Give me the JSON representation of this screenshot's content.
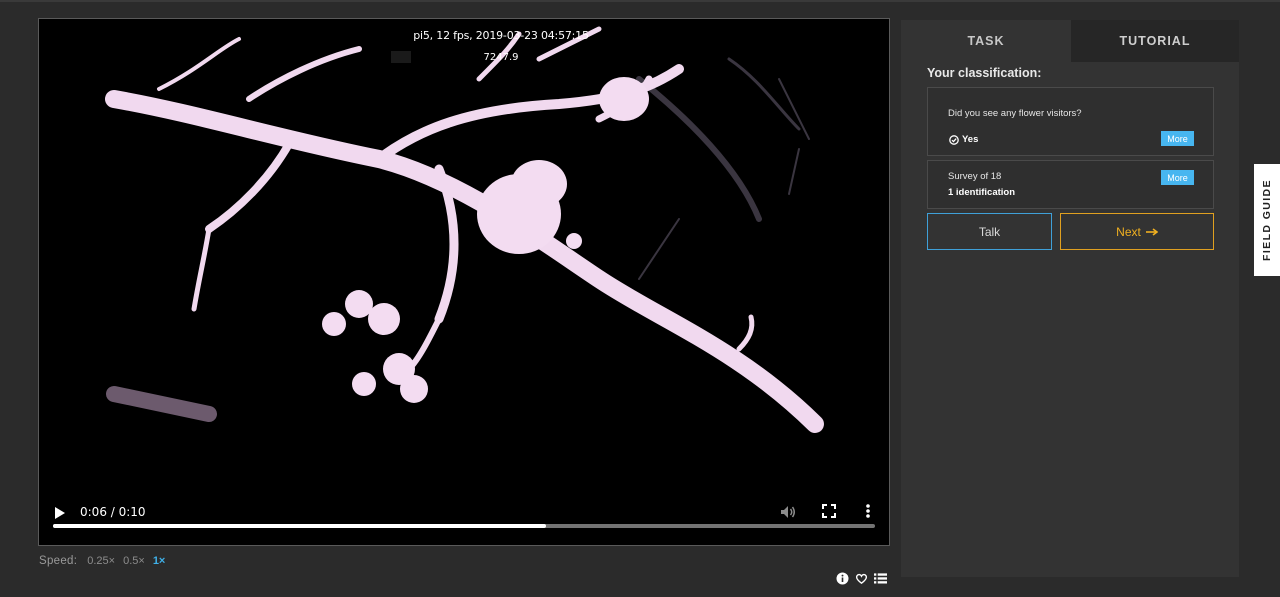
{
  "video": {
    "overlay_line1": "pi5, 12 fps, 2019-03-23 04:57:15",
    "overlay_line2": "7247.9",
    "time": "0:06 / 0:10",
    "progress_percent": 60,
    "icons": [
      "play-icon",
      "volume-icon",
      "fullscreen-icon",
      "more-vertical-icon"
    ]
  },
  "speed": {
    "label": "Speed:",
    "options": [
      "0.25×",
      "0.5×",
      "1×"
    ],
    "active": "1×"
  },
  "meta_icons": [
    "info-icon",
    "heart-icon",
    "list-icon"
  ],
  "tabs": {
    "task": "TASK",
    "tutorial": "TUTORIAL",
    "active": "TASK"
  },
  "classification": {
    "title": "Your classification:",
    "question": "Did you see any flower visitors?",
    "answer": "Yes",
    "more_label": "More",
    "survey_title": "Survey of 18",
    "survey_count": "1 identification"
  },
  "actions": {
    "talk": "Talk",
    "next": "Next"
  },
  "field_guide": "FIELD GUIDE",
  "colors": {
    "accent_blue": "#47b6f0",
    "next_gold": "#f0b020",
    "talk_border": "#3fa0d8",
    "panel_bg": "#333333",
    "page_bg": "#2b2b2b"
  }
}
